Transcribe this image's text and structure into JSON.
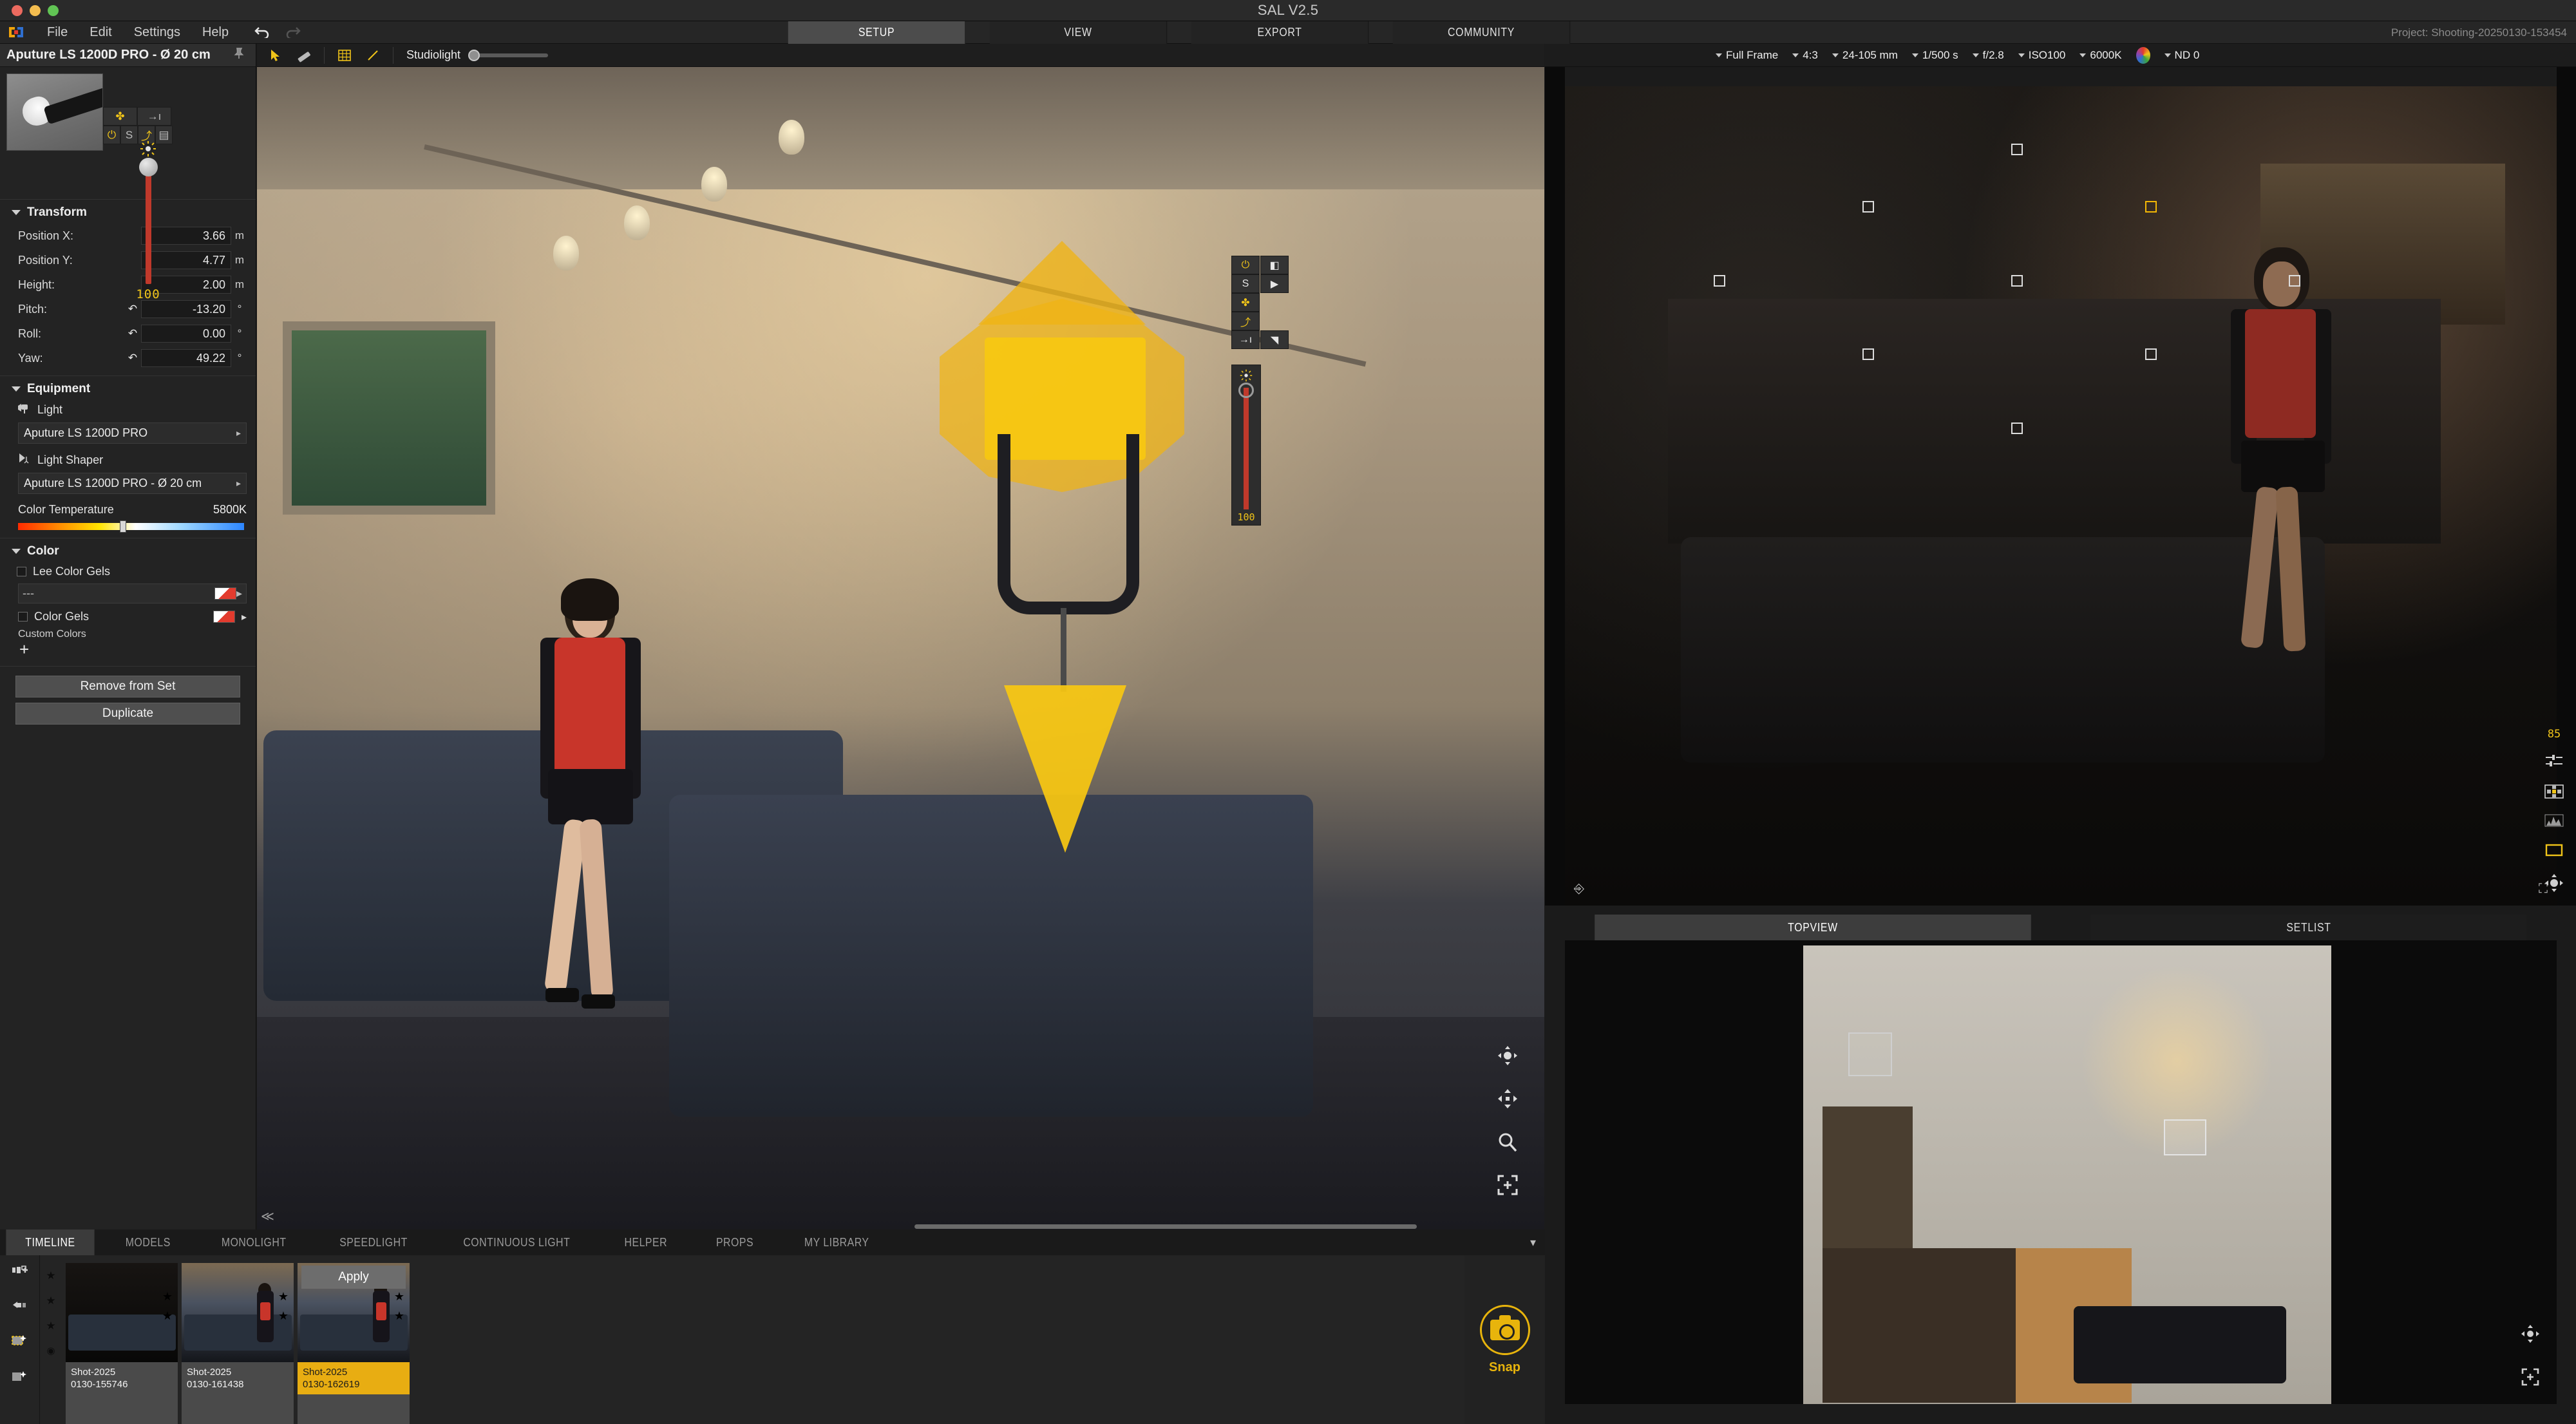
{
  "window": {
    "app_title": "SAL V2.5"
  },
  "menu": {
    "items": [
      "File",
      "Edit",
      "Settings",
      "Help"
    ],
    "undo_icon": "undo-icon",
    "redo_icon": "redo-icon",
    "logo_icon": "app-logo-icon"
  },
  "nav": {
    "tabs": [
      {
        "label": "SETUP",
        "active": true
      },
      {
        "label": "VIEW",
        "active": false
      },
      {
        "label": "EXPORT",
        "active": false
      },
      {
        "label": "COMMUNITY",
        "active": false
      }
    ],
    "project": "Project: Shooting-20250130-153454"
  },
  "left_panel": {
    "header_title": "Aputure LS 1200D PRO - Ø 20 cm",
    "pin_icon": "pin-icon",
    "quick_buttons": [
      {
        "name": "move-gizmo-icon",
        "glyph": "✤"
      },
      {
        "name": "target-person-icon",
        "glyph": "→ı"
      },
      {
        "name": "power-icon",
        "glyph": "⏻"
      },
      {
        "name": "solo-icon",
        "glyph": "S"
      },
      {
        "name": "stand-icon",
        "glyph": "⤴"
      },
      {
        "name": "barndoor-icon",
        "glyph": "▤"
      }
    ],
    "intensity": {
      "label": "intensity-slider",
      "value": "100",
      "sun_icon": "brightness-icon"
    },
    "transform": {
      "title": "Transform",
      "rows": [
        {
          "label": "Position X:",
          "value": "3.66",
          "unit": "m",
          "reset": false
        },
        {
          "label": "Position Y:",
          "value": "4.77",
          "unit": "m",
          "reset": false
        },
        {
          "label": "Height:",
          "value": "2.00",
          "unit": "m",
          "reset": false
        },
        {
          "label": "Pitch:",
          "value": "-13.20",
          "unit": "°",
          "reset": true
        },
        {
          "label": "Roll:",
          "value": "0.00",
          "unit": "°",
          "reset": true
        },
        {
          "label": "Yaw:",
          "value": "49.22",
          "unit": "°",
          "reset": true
        }
      ]
    },
    "equipment": {
      "title": "Equipment",
      "light_label": "Light",
      "light_value": "Aputure LS 1200D PRO",
      "shaper_label": "Light Shaper",
      "shaper_value": "Aputure LS 1200D PRO - Ø 20 cm",
      "color_temp_label": "Color Temperature",
      "color_temp_value": "5800K"
    },
    "color": {
      "title": "Color",
      "lee_label": "Lee Color Gels",
      "lee_value": "---",
      "gels_label": "Color Gels",
      "custom_colors_label": "Custom Colors",
      "add_icon": "plus-icon"
    },
    "actions": {
      "remove": "Remove from Set",
      "duplicate": "Duplicate"
    }
  },
  "viewport_toolbar": {
    "tools": [
      {
        "name": "select-cursor-icon",
        "glyph": "➤"
      },
      {
        "name": "measure-ruler-icon",
        "glyph": "╱"
      },
      {
        "name": "grid-icon",
        "glyph": "▦"
      },
      {
        "name": "line-icon",
        "glyph": "╱"
      }
    ],
    "studiolight_label": "Studiolight"
  },
  "viewport": {
    "float_tools": [
      {
        "name": "power-icon",
        "glyph": "⏻"
      },
      {
        "name": "barndoor-icon",
        "glyph": "◧"
      },
      {
        "name": "solo-icon",
        "glyph": "S"
      },
      {
        "name": "play-icon",
        "glyph": "▶"
      },
      {
        "name": "move-gizmo-icon",
        "glyph": "✤"
      },
      {
        "name": "stand-icon",
        "glyph": "⤴"
      },
      {
        "name": "target-person-icon",
        "glyph": "→ı"
      },
      {
        "name": "gel-icon",
        "glyph": "◥"
      }
    ],
    "intensity_value": "100",
    "nav_icons": [
      {
        "name": "orbit-icon",
        "glyph": "✥"
      },
      {
        "name": "pan-icon",
        "glyph": "✥"
      },
      {
        "name": "zoom-icon",
        "glyph": "⌕"
      },
      {
        "name": "fit-view-icon",
        "glyph": "⛶"
      }
    ],
    "collapse_icon": "collapse-left-icon"
  },
  "camera_bar": {
    "items": [
      {
        "name": "sensor-format",
        "label": "Full Frame",
        "caret": true
      },
      {
        "name": "aspect-ratio",
        "label": "4:3",
        "caret": true
      },
      {
        "name": "focal-length",
        "label": "24-105 mm",
        "caret": true
      },
      {
        "name": "shutter-speed",
        "label": "1/500 s",
        "caret": true
      },
      {
        "name": "aperture",
        "label": "f/2.8",
        "caret": true
      },
      {
        "name": "iso",
        "label": "ISO100",
        "caret": true
      },
      {
        "name": "white-balance",
        "label": "6000K",
        "caret": true
      },
      {
        "name": "nd-filter",
        "label": "ND 0",
        "caret": true
      }
    ],
    "color_wheel_icon": "color-wheel-icon"
  },
  "preview": {
    "focus_points": [
      {
        "x": 45,
        "y": 7,
        "selected": false
      },
      {
        "x": 30,
        "y": 14,
        "selected": false
      },
      {
        "x": 58,
        "y": 14,
        "selected": true
      },
      {
        "x": 15,
        "y": 23,
        "selected": false
      },
      {
        "x": 45,
        "y": 23,
        "selected": false
      },
      {
        "x": 73,
        "y": 23,
        "selected": false
      },
      {
        "x": 30,
        "y": 32,
        "selected": false
      },
      {
        "x": 58,
        "y": 32,
        "selected": false
      },
      {
        "x": 45,
        "y": 40,
        "selected": false
      }
    ],
    "right_rail": {
      "value": "85",
      "icons": [
        {
          "name": "levels-sliders-icon",
          "glyph": "≡"
        },
        {
          "name": "focus-grid-icon",
          "glyph": "⊞"
        },
        {
          "name": "histogram-icon",
          "glyph": "▂▆▃"
        },
        {
          "name": "frame-guide-icon",
          "glyph": "▭"
        },
        {
          "name": "pan-pad-icon",
          "glyph": "✥"
        }
      ]
    },
    "bottom_left_icon": "camera-flip-icon",
    "bottom_right_icon": "fullscreen-icon"
  },
  "topview": {
    "tabs": [
      {
        "label": "TOPVIEW",
        "active": true
      },
      {
        "label": "SETLIST",
        "active": false
      }
    ],
    "nav_icons": [
      {
        "name": "pan-icon",
        "glyph": "✥"
      },
      {
        "name": "fit-view-icon",
        "glyph": "⛶"
      }
    ]
  },
  "timeline": {
    "tabs": [
      {
        "label": "TIMELINE",
        "active": true
      },
      {
        "label": "MODELS",
        "active": false
      },
      {
        "label": "MONOLIGHT",
        "active": false
      },
      {
        "label": "SPEEDLIGHT",
        "active": false
      },
      {
        "label": "CONTINUOUS LIGHT",
        "active": false
      },
      {
        "label": "HELPER",
        "active": false
      },
      {
        "label": "PROPS",
        "active": false
      },
      {
        "label": "MY LIBRARY",
        "active": false
      }
    ],
    "collapse_icon": "chevron-down-icon",
    "sidebar_icons": [
      {
        "name": "add-shot-icon",
        "glyph": "▣"
      },
      {
        "name": "load-shot-icon",
        "glyph": "←"
      },
      {
        "name": "enhance-shot-icon",
        "glyph": "✦"
      },
      {
        "name": "enhance-alt-icon",
        "glyph": "✦"
      }
    ],
    "rating_icons": [
      {
        "name": "star-icon",
        "glyph": "★"
      },
      {
        "name": "star-icon",
        "glyph": "★"
      },
      {
        "name": "star-icon",
        "glyph": "★"
      },
      {
        "name": "eye-icon",
        "glyph": "◉"
      }
    ],
    "shots": [
      {
        "line1": "Shot-2025",
        "line2": "0130-155746",
        "selected": false,
        "apply": null,
        "style": "dark"
      },
      {
        "line1": "Shot-2025",
        "line2": "0130-161438",
        "selected": false,
        "apply": null,
        "style": "mid"
      },
      {
        "line1": "Shot-2025",
        "line2": "0130-162619",
        "selected": true,
        "apply": "Apply",
        "style": "mid"
      }
    ],
    "snap": {
      "label": "Snap",
      "icon": "camera-icon"
    }
  },
  "colors": {
    "accent_yellow": "#e8b40c",
    "panel_bg": "#232323",
    "slider_red": "#c0392b"
  }
}
